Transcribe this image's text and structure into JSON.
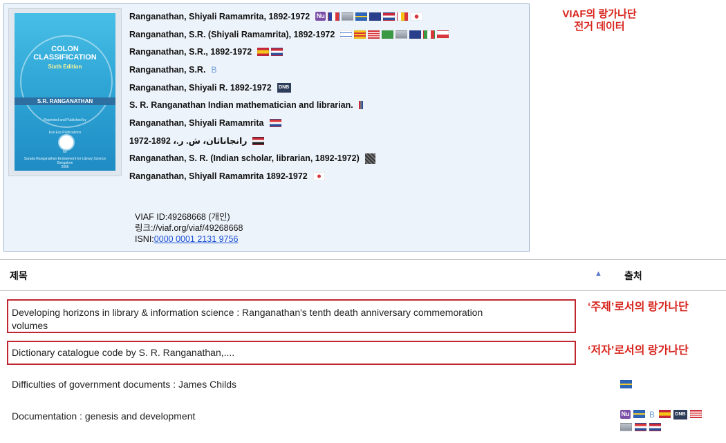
{
  "authority": {
    "cover": {
      "title_line1": "COLON",
      "title_line2": "CLASSIFICATION",
      "edition": "Sixth Edition",
      "author": "S.R. RANGANATHAN",
      "note1": "Reprinted and Published by",
      "publisher": "Ess Ess Publications",
      "for": "for",
      "endowment": "Sarada Ranganathan Endowment for Library Science",
      "city": "Bangalore",
      "year": "2006"
    },
    "names": [
      {
        "text": "Ranganathan, Shiyali Ramamrita, 1892-1972",
        "icons": [
          "nu-badge",
          "gray-flag",
          "gray-flag",
          "sweden-flag",
          "gray-flag",
          "netherlands-flag",
          "belgium-flag",
          "japan-flag"
        ]
      },
      {
        "text": "Ranganathan, S.R. (Shiyali Ramamrita), 1892-1972",
        "icons": [
          "israel-flag",
          "catalonia-flag",
          "usa-flag",
          "brazil-flag",
          "gray-flag",
          "australia-flag",
          "italy-flag",
          "czech-flag"
        ]
      },
      {
        "text": "Ranganathan, S.R., 1892-1972",
        "icons": [
          "spain-flag",
          "netherlands-flag"
        ]
      },
      {
        "text": "Ranganathan, S.R.",
        "icons": [
          "b-badge"
        ]
      },
      {
        "text": "Ranganathan, Shiyali R. 1892-1972",
        "icons": [
          "dnb-badge"
        ]
      },
      {
        "text": "S. R. Ranganathan Indian mathematician and librarian.",
        "icons": [
          "vi-badge"
        ]
      },
      {
        "text": "Ranganathan, Shiyali Ramamrita",
        "icons": [
          "croatia-flag"
        ]
      },
      {
        "text": "رانجاناثان، ش. ر.، 1892-1972",
        "icons": [
          "arab-flag"
        ]
      },
      {
        "text": "Ranganathan, S. R. (Indian scholar, librarian, 1892-1972)",
        "icons": [
          "dark-badge"
        ]
      },
      {
        "text": "Ranganathan, Shiyall Ramamrita 1892-1972",
        "icons": [
          "korea-flag"
        ]
      }
    ],
    "viaf_id": "VIAF ID:49268668 (개인)",
    "link": "링크://viaf.org/viaf/49268668",
    "isni_label": "ISNI:",
    "isni_value": "0000 0001 2131 9756"
  },
  "annotations": {
    "viaf_line1": "VIAF의 랑가나단",
    "viaf_line2": "전거 데이터",
    "subject": "‘주제’로서의 랑가나단",
    "author": "‘저자’로서의 랑가나단"
  },
  "table": {
    "header_title": "제목",
    "sort_icon": "▲",
    "header_source": "출처",
    "rows": [
      {
        "title_line1": "Developing horizons in library & information science : Ranganathan's tenth death anniversary commemoration",
        "title_line2": "volumes"
      },
      {
        "title_line1": "Dictionary catalogue code by S. R. Ranganathan,...."
      },
      {
        "title_line1": "Difficulties of government documents : James Childs",
        "icons": [
          "sweden-flag"
        ]
      },
      {
        "title_line1": "Documentation : genesis and development",
        "icons": [
          "nu-badge",
          "sweden-flag",
          "b-badge",
          "spain-flag",
          "dnb-badge",
          "usa-flag",
          "gray-flag",
          "croatia-flag",
          "netherlands-flag"
        ]
      }
    ]
  },
  "icon_labels": {
    "nu": "Nu",
    "b": "B",
    "dnb": "DNB"
  }
}
